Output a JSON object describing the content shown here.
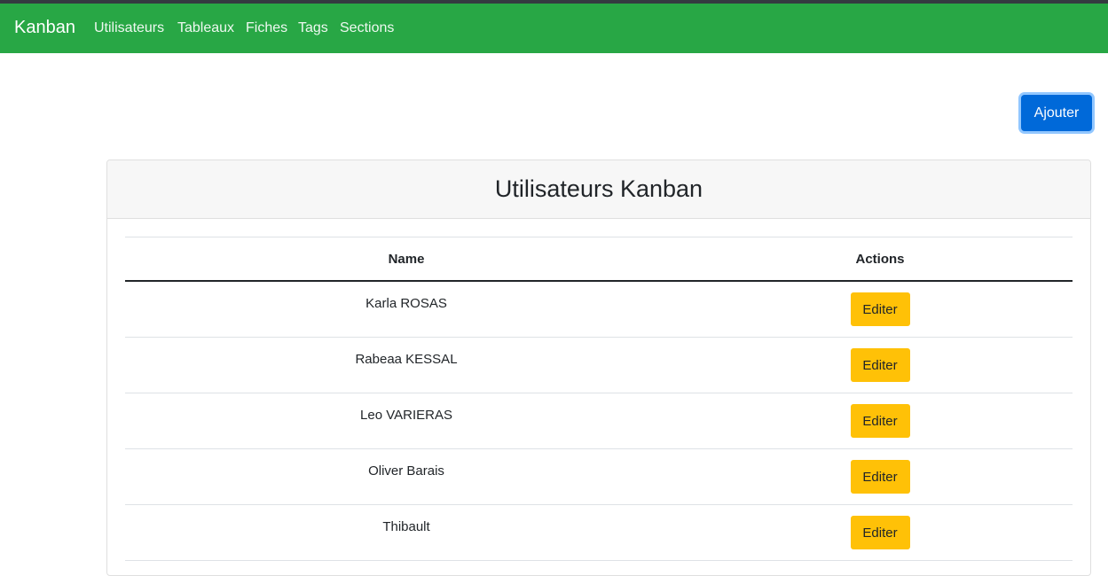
{
  "navbar": {
    "brand": "Kanban",
    "links": [
      "Utilisateurs",
      "Tableaux",
      "Fiches",
      "Tags",
      "Sections"
    ],
    "background": "#28a745"
  },
  "add_button_label": "Ajouter",
  "card": {
    "title": "Utilisateurs Kanban",
    "columns": [
      "Name",
      "Actions"
    ],
    "rows": [
      {
        "name": "Karla ROSAS",
        "action": "Editer"
      },
      {
        "name": "Rabeaa KESSAL",
        "action": "Editer"
      },
      {
        "name": "Leo VARIERAS",
        "action": "Editer"
      },
      {
        "name": "Oliver Barais",
        "action": "Editer"
      },
      {
        "name": "Thibault",
        "action": "Editer"
      }
    ]
  },
  "colors": {
    "primary": "#0069d9",
    "warning": "#ffc107"
  }
}
